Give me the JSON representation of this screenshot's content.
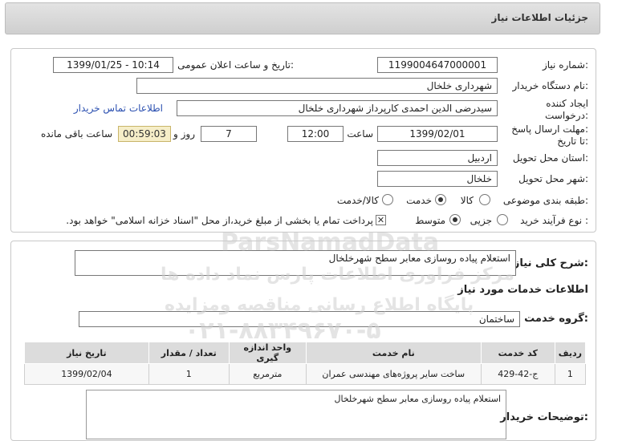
{
  "page_title": "جزئیات اطلاعات نیاز",
  "form": {
    "need_number_label": "شماره نیاز:",
    "need_number": "1199004647000001",
    "announce_label": "تاریخ و ساعت اعلان عمومی:",
    "announce_value": "1399/01/25 - 10:14",
    "buyer_org_label": "نام دستگاه خریدار:",
    "buyer_org": "شهرداری خلخال",
    "creator_label_1": "ایجاد کننده",
    "creator_label_2": "درخواست:",
    "creator": "سیدرضی الدین  احمدی کارپرداز شهرداری خلخال",
    "contact_link": "اطلاعات تماس خریدار",
    "deadline_label_1": "مهلت ارسال پاسخ:",
    "deadline_label_2": "تا تاریخ:",
    "deadline_date": "1399/02/01",
    "time_label": "ساعت",
    "deadline_time": "12:00",
    "days_value": "7",
    "days_label": "روز و",
    "remaining_time": "00:59:03",
    "remaining_label": "ساعت باقی مانده",
    "province_label": "استان محل تحویل:",
    "province": "اردبیل",
    "city_label": "شهر محل تحویل:",
    "city": "خلخال",
    "category_label": "طبقه بندی موضوعی:",
    "category_options": [
      "کالا",
      "خدمت",
      "کالا/خدمت"
    ],
    "category_selected": "خدمت",
    "process_label": "نوع فرآیند خرید :",
    "process_options": [
      "جزیی",
      "متوسط"
    ],
    "process_selected": "متوسط",
    "payment_note": "پرداخت تمام یا بخشی از مبلغ خرید،از محل \"اسناد خزانه اسلامی\" خواهد بود."
  },
  "details": {
    "general_desc_label": "شرح کلی نیاز:",
    "general_desc": "استعلام پیاده روسازی معابر سطح شهرخلخال",
    "services_info_title": "اطلاعات خدمات مورد نیاز",
    "service_group_label": "گروه خدمت:",
    "service_group": "ساختمان",
    "table": {
      "headers": [
        "ردیف",
        "کد خدمت",
        "نام خدمت",
        "واحد اندازه گیری",
        "تعداد / مقدار",
        "تاریخ نیاز"
      ],
      "rows": [
        [
          "1",
          "ج-42-429",
          "ساخت سایر پروژه‌های مهندسی عمران",
          "مترمربع",
          "1",
          "1399/02/04"
        ]
      ]
    },
    "buyer_notes_label": "توضیحات خریدار:",
    "buyer_notes": "استعلام پیاده روسازی معابر سطح شهرخلخال"
  },
  "watermark": {
    "line1": "ParsNamadData",
    "line2": "مرکز فراوری اطلاعات پارس نماد داده ها",
    "line3": "پایگاه اطلاع رسانی مناقصه ومزایده",
    "line4": "۰۲۱-۸۸۳۴۹۶۷۰-۵"
  }
}
